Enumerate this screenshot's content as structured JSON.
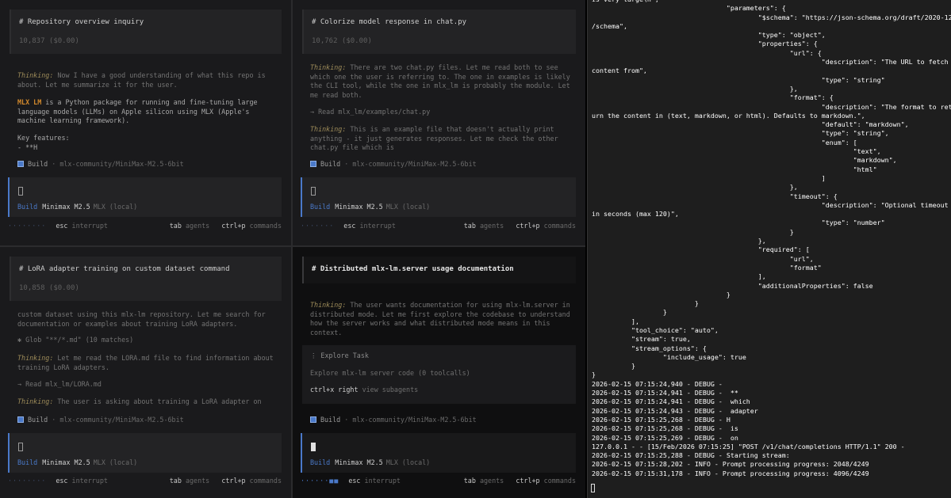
{
  "panes": {
    "tl": {
      "title": "# Repository overview inquiry",
      "meta": "10,837 ($0.00)",
      "thinking_label": "Thinking:",
      "thinking_text": " Now I have a good understanding of what this repo is about. Let me summarize it for the user.",
      "highlight": "MLX LM",
      "body": " is a Python package for running and fine-tuning large language models (LLMs) on Apple silicon using MLX (Apple's machine learning framework).",
      "features_title": "Key features:",
      "features_item": "- **H",
      "build_agent": "Build",
      "build_model": "· mlx-community/MiniMax-M2.5-6bit",
      "input_agent": "Build",
      "input_model": "Minimax M2.5",
      "input_provider": "MLX (local)",
      "status_dots": "········",
      "status_esc": "esc",
      "status_esc_label": "interrupt",
      "tab_key": "tab",
      "tab_label": "agents",
      "cmd_key": "ctrl+p",
      "cmd_label": "commands"
    },
    "tr": {
      "title": "# Colorize model response in chat.py",
      "meta": "10,762 ($0.00)",
      "thinking_label": "Thinking:",
      "thinking_text": " There are two chat.py files. Let me read both to see which one the user is referring to. The one in examples is likely the CLI tool, while the one in mlx_lm is probably the module. Let me read both.",
      "read_line": "→ Read mlx_lm/examples/chat.py",
      "thinking2_label": "Thinking:",
      "thinking2_text": " This is an example file that doesn't actually print anything - it just generates responses. Let me check the other chat.py file which is",
      "build_agent": "Build",
      "build_model": "· mlx-community/MiniMax-M2.5-6bit",
      "input_agent": "Build",
      "input_model": "Minimax M2.5",
      "input_provider": "MLX (local)",
      "status_dots": "·······",
      "status_esc": "esc",
      "status_esc_label": "interrupt",
      "tab_key": "tab",
      "tab_label": "agents",
      "cmd_key": "ctrl+p",
      "cmd_label": "commands"
    },
    "bl": {
      "title": "# LoRA adapter training on custom dataset command",
      "meta": "10,858 ($0.00)",
      "intro": "custom dataset using this mlx-lm repository. Let me search for documentation or examples about training LoRA adapters.",
      "glob_line": "✱ Glob \"**/*.md\" (10 matches)",
      "thinking_label": "Thinking:",
      "thinking_text": " Let me read the LORA.md file to find information about training LoRA adapters.",
      "read_line": "→ Read mlx_lm/LORA.md",
      "thinking2_label": "Thinking:",
      "thinking2_text": " The user is asking about training a LoRA adapter on",
      "build_agent": "Build",
      "build_model": "· mlx-community/MiniMax-M2.5-6bit",
      "input_agent": "Build",
      "input_model": "Minimax M2.5",
      "input_provider": "MLX (local)",
      "status_dots": "········",
      "status_esc": "esc",
      "status_esc_label": "interrupt",
      "tab_key": "tab",
      "tab_label": "agents",
      "cmd_key": "ctrl+p",
      "cmd_label": "commands"
    },
    "br": {
      "title": "# Distributed mlx-lm.server usage documentation",
      "thinking_label": "Thinking:",
      "thinking_text": " The user wants documentation for using mlx-lm.server in distributed mode. Let me first explore the codebase to understand how the server works and what distributed mode means in this context.",
      "task_title": "⋮ Explore Task",
      "task_desc": "Explore mlx-lm server code (0 toolcalls)",
      "task_key": "ctrl+x right",
      "task_key_label": "view subagents",
      "build_agent": "Build",
      "build_model": "· mlx-community/MiniMax-M2.5-6bit",
      "input_agent": "Build",
      "input_model": "Minimax M2.5",
      "input_provider": "MLX (local)",
      "status_dots": "······■■",
      "status_esc": "esc",
      "status_esc_label": "interrupt",
      "tab_key": "tab",
      "tab_label": "agents",
      "cmd_key": "ctrl+p",
      "cmd_label": "commands"
    }
  },
  "terminal": {
    "text": "is very large\\n\",\n                                  \"parameters\": {\n                                          \"$schema\": \"https://json-schema.org/draft/2020-12\n/schema\",\n                                          \"type\": \"object\",\n                                          \"properties\": {\n                                                  \"url\": {\n                                                          \"description\": \"The URL to fetch\ncontent from\",\n                                                          \"type\": \"string\"\n                                                  },\n                                                  \"format\": {\n                                                          \"description\": \"The format to ret\nurn the content in (text, markdown, or html). Defaults to markdown.\",\n                                                          \"default\": \"markdown\",\n                                                          \"type\": \"string\",\n                                                          \"enum\": [\n                                                                  \"text\",\n                                                                  \"markdown\",\n                                                                  \"html\"\n                                                          ]\n                                                  },\n                                                  \"timeout\": {\n                                                          \"description\": \"Optional timeout\nin seconds (max 120)\",\n                                                          \"type\": \"number\"\n                                                  }\n                                          },\n                                          \"required\": [\n                                                  \"url\",\n                                                  \"format\"\n                                          ],\n                                          \"additionalProperties\": false\n                                  }\n                          }\n                  }\n          ],\n          \"tool_choice\": \"auto\",\n          \"stream\": true,\n          \"stream_options\": {\n                  \"include_usage\": true\n          }\n}\n2026-02-15 07:15:24,940 - DEBUG -\n2026-02-15 07:15:24,941 - DEBUG -  **\n2026-02-15 07:15:24,941 - DEBUG -  which\n2026-02-15 07:15:24,943 - DEBUG -  adapter\n2026-02-15 07:15:25,268 - DEBUG - H\n2026-02-15 07:15:25,268 - DEBUG -  is\n2026-02-15 07:15:25,269 - DEBUG -  on\n127.0.0.1 - - [15/Feb/2026 07:15:25] \"POST /v1/chat/completions HTTP/1.1\" 200 -\n2026-02-15 07:15:25,288 - DEBUG - Starting stream:\n2026-02-15 07:15:28,202 - INFO - Prompt processing progress: 2048/4249\n2026-02-15 07:15:31,178 - INFO - Prompt processing progress: 4096/4249"
  },
  "colors": {
    "accent": "#4a79c9",
    "thinking": "#9d8b59",
    "highlight": "#d48a2c",
    "background": "#1c1c1e"
  }
}
